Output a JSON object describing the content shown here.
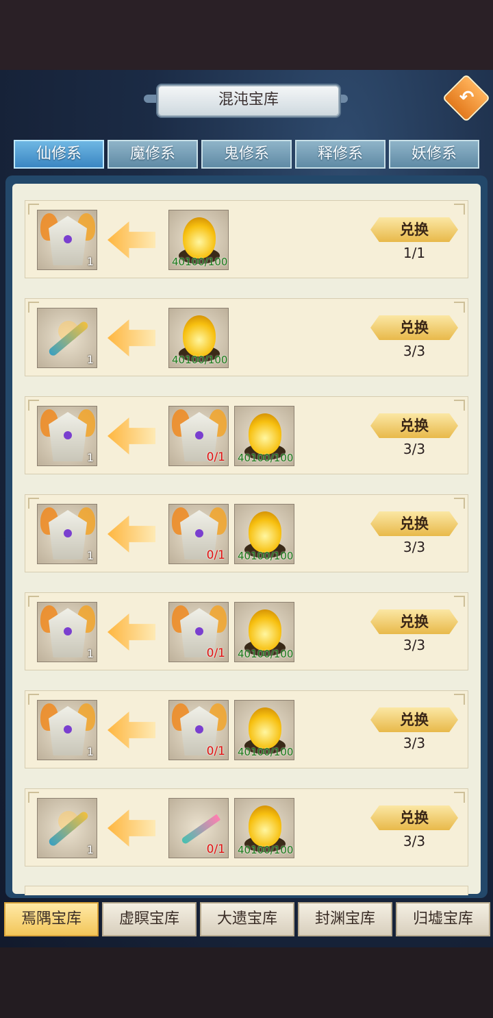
{
  "header": {
    "title": "混沌宝库",
    "back_icon": "back-arrow-icon"
  },
  "top_tabs": [
    {
      "label": "仙修系",
      "active": true
    },
    {
      "label": "魔修系",
      "active": false
    },
    {
      "label": "鬼修系",
      "active": false
    },
    {
      "label": "释修系",
      "active": false
    },
    {
      "label": "妖修系",
      "active": false
    }
  ],
  "rows": [
    {
      "reward": {
        "icon": "robe-icon",
        "count": "1"
      },
      "costs": [
        {
          "icon": "fire-orb-icon",
          "progress": "40100/100"
        }
      ],
      "button": "兑换",
      "limit": "1/1"
    },
    {
      "reward": {
        "icon": "sword-icon",
        "count": "1"
      },
      "costs": [
        {
          "icon": "fire-orb-icon",
          "progress": "40100/100"
        }
      ],
      "button": "兑换",
      "limit": "3/3"
    },
    {
      "reward": {
        "icon": "robe-icon",
        "count": "1"
      },
      "costs": [
        {
          "icon": "robe-icon",
          "progress": "0/1"
        },
        {
          "icon": "fire-orb-icon",
          "progress": "40100/100"
        }
      ],
      "button": "兑换",
      "limit": "3/3"
    },
    {
      "reward": {
        "icon": "robe-icon",
        "count": "1"
      },
      "costs": [
        {
          "icon": "robe-icon",
          "progress": "0/1"
        },
        {
          "icon": "fire-orb-icon",
          "progress": "40100/100"
        }
      ],
      "button": "兑换",
      "limit": "3/3"
    },
    {
      "reward": {
        "icon": "robe-icon",
        "count": "1"
      },
      "costs": [
        {
          "icon": "robe-icon",
          "progress": "0/1"
        },
        {
          "icon": "fire-orb-icon",
          "progress": "40100/100"
        }
      ],
      "button": "兑换",
      "limit": "3/3"
    },
    {
      "reward": {
        "icon": "robe-icon",
        "count": "1"
      },
      "costs": [
        {
          "icon": "robe-icon",
          "progress": "0/1"
        },
        {
          "icon": "fire-orb-icon",
          "progress": "40100/100"
        }
      ],
      "button": "兑换",
      "limit": "3/3"
    },
    {
      "reward": {
        "icon": "sword-icon",
        "count": "1"
      },
      "costs": [
        {
          "icon": "blade-icon",
          "progress": "0/1"
        },
        {
          "icon": "fire-orb-icon",
          "progress": "40100/100"
        }
      ],
      "button": "兑换",
      "limit": "3/3"
    }
  ],
  "bottom_tabs": [
    {
      "label": "焉隅宝库",
      "active": true
    },
    {
      "label": "虚瞑宝库",
      "active": false
    },
    {
      "label": "大遗宝库",
      "active": false
    },
    {
      "label": "封渊宝库",
      "active": false
    },
    {
      "label": "归墟宝库",
      "active": false
    }
  ],
  "colors": {
    "accent_gold": "#e8b94a",
    "tab_blue": "#3a86c2",
    "count_red": "#e01010",
    "count_green": "#1a7a1a"
  }
}
